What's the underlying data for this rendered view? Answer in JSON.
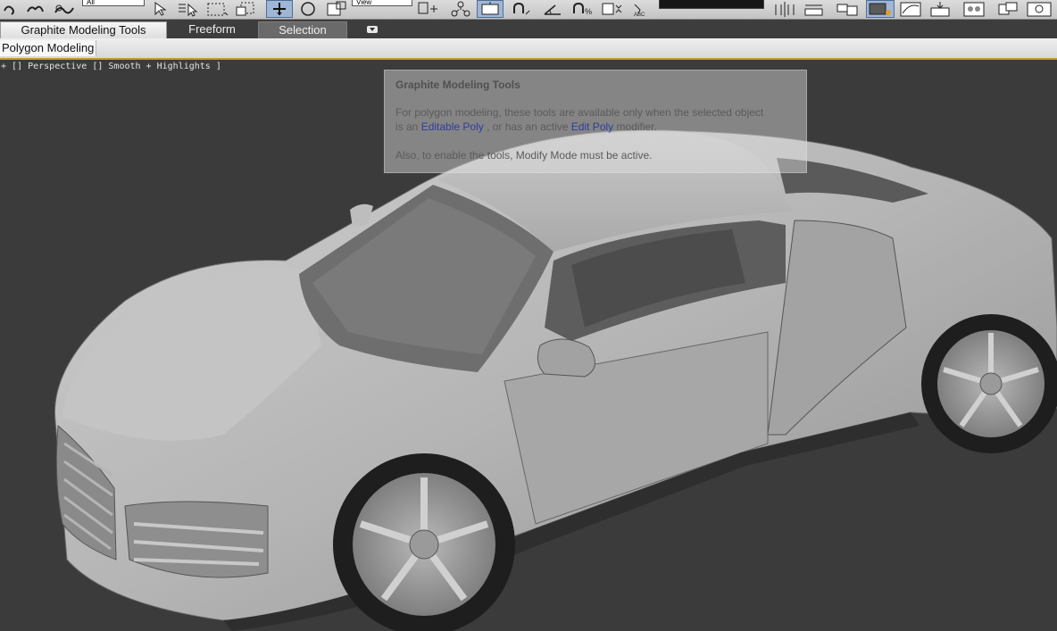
{
  "toolbar": {
    "filter_value": "All",
    "reference_value": "View",
    "selection_set_value": ""
  },
  "ribbon": {
    "tabs": [
      {
        "label": "Graphite Modeling Tools"
      },
      {
        "label": "Freeform"
      },
      {
        "label": "Selection"
      }
    ],
    "panel_label": "Polygon Modeling"
  },
  "viewport": {
    "label": "+ [] Perspective [] Smooth + Highlights ]"
  },
  "tooltip": {
    "title": "Graphite Modeling Tools",
    "line1": "For polygon modeling, these tools are available only when the selected object",
    "line2_a": "is an ",
    "link1": "Editable Poly",
    "line2_b": " , or has an active ",
    "link2": "Edit Poly",
    "line2_c": " modifier.",
    "line3": "Also, to enable the tools, Modify Mode must be active."
  },
  "colors": {
    "viewport_bg": "#3b3b3b",
    "link": "#2f3d9a",
    "panel_accent": "#c09a32"
  }
}
